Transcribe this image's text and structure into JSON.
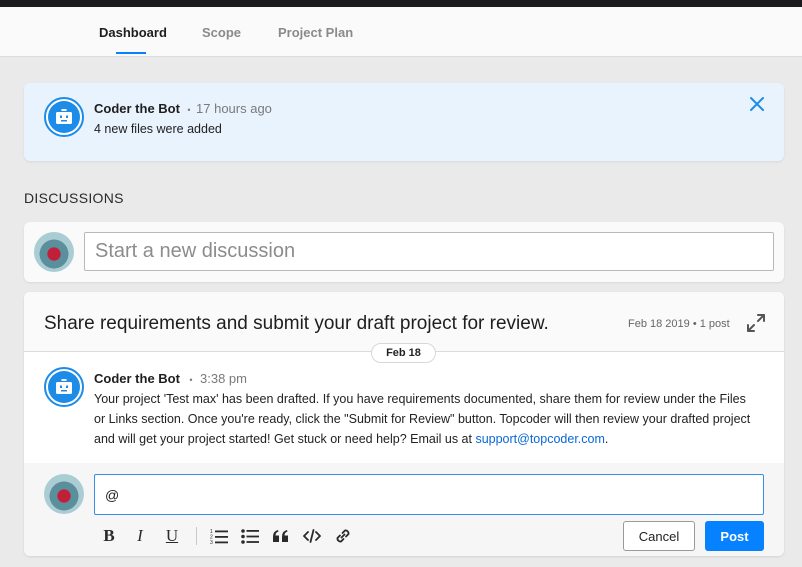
{
  "tabs": [
    {
      "label": "Dashboard",
      "active": true
    },
    {
      "label": "Scope",
      "active": false
    },
    {
      "label": "Project Plan",
      "active": false
    }
  ],
  "notification": {
    "author": "Coder the Bot",
    "separator": "•",
    "time": "17 hours ago",
    "text": "4 new files were added"
  },
  "discussions": {
    "section_title": "DISCUSSIONS",
    "new_placeholder": "Start a new discussion"
  },
  "thread": {
    "title": "Share requirements and submit your draft project for review.",
    "meta": "Feb 18 2019 • 1 post",
    "date_divider": "Feb 18",
    "post": {
      "author": "Coder the Bot",
      "separator": "•",
      "time": "3:38 pm",
      "body": "Your project 'Test max' has been drafted. If you have requirements documented, share them for review under the Files or Links section. Once you're ready, click the \"Submit for Review\" button. Topcoder will then review your drafted project and will get your project started! Get stuck or need help? Email us at ",
      "link": "support@topcoder.com",
      "end": "."
    },
    "reply": {
      "value": "@",
      "cancel_label": "Cancel",
      "post_label": "Post"
    }
  },
  "colors": {
    "accent": "#0681ff",
    "bot_blue": "#1d8be8",
    "notif_bg": "#e9f3fd",
    "link": "#0a67d8"
  },
  "icons": {
    "close": "close-icon",
    "expand": "expand-icon",
    "bot": "robot-icon",
    "format": [
      "bold-icon",
      "italic-icon",
      "underline-icon",
      "ordered-list-icon",
      "bullet-list-icon",
      "quote-icon",
      "code-icon",
      "link-icon"
    ]
  }
}
